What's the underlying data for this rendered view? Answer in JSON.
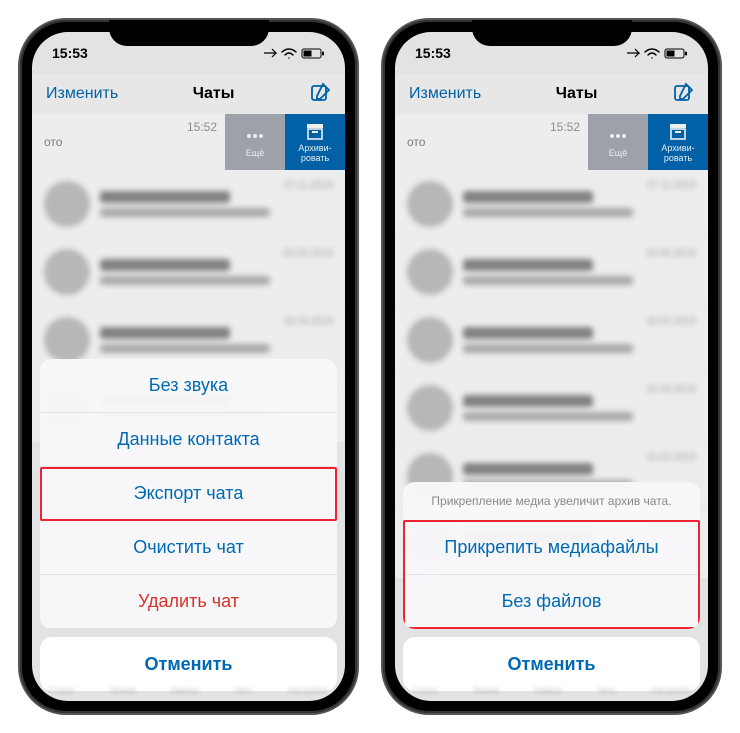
{
  "status": {
    "time": "15:53"
  },
  "nav": {
    "edit": "Изменить",
    "title": "Чаты"
  },
  "swipe": {
    "time": "15:52",
    "more": "Ещё",
    "archive_l1": "Архиви-",
    "archive_l2": "ровать"
  },
  "sheet1": {
    "items": [
      {
        "label": "Без звука",
        "destructive": false
      },
      {
        "label": "Данные контакта",
        "destructive": false
      },
      {
        "label": "Экспорт чата",
        "destructive": false,
        "highlight": true
      },
      {
        "label": "Очистить чат",
        "destructive": false
      },
      {
        "label": "Удалить чат",
        "destructive": true
      }
    ],
    "cancel": "Отменить"
  },
  "sheet2": {
    "message": "Прикрепление медиа увеличит архив чата.",
    "items": [
      {
        "label": "Прикрепить медиафайлы"
      },
      {
        "label": "Без файлов"
      }
    ],
    "cancel": "Отменить"
  },
  "tabs": [
    "Статус",
    "Звонки",
    "Камера",
    "Чаты",
    "Настройки"
  ]
}
